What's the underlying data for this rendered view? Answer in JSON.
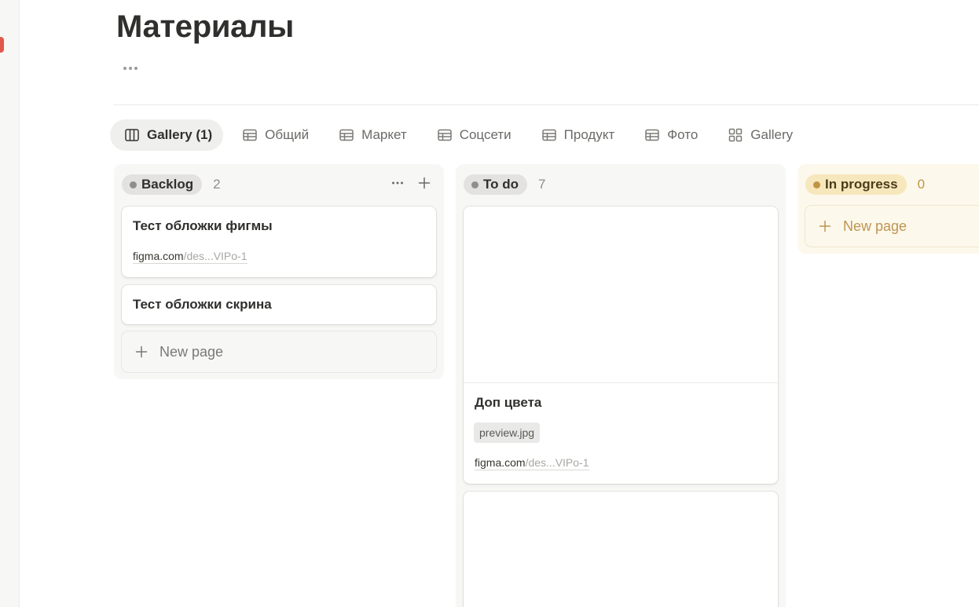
{
  "page": {
    "title": "Материалы",
    "more_label": "More options"
  },
  "tabs": [
    {
      "label": "Gallery (1)",
      "icon": "board-icon",
      "active": true
    },
    {
      "label": "Общий",
      "icon": "table-icon"
    },
    {
      "label": "Маркет",
      "icon": "table-icon"
    },
    {
      "label": "Соцсети",
      "icon": "table-icon"
    },
    {
      "label": "Продукт",
      "icon": "table-icon"
    },
    {
      "label": "Фото",
      "icon": "table-icon"
    },
    {
      "label": "Gallery",
      "icon": "gallery-icon"
    }
  ],
  "columns": {
    "backlog": {
      "status": "Backlog",
      "count": "2",
      "color": "#8f8e8a",
      "cards": [
        {
          "title": "Тест обложки фигмы",
          "link_domain": "figma.com",
          "link_rest": "/des...VIPo-1"
        },
        {
          "title": "Тест обложки скрина"
        }
      ],
      "new_page": "New page"
    },
    "todo": {
      "status": "To do",
      "count": "7",
      "color": "#8f8e8a",
      "cards": [
        {
          "title": "Доп цвета",
          "file": "preview.jpg",
          "link_domain": "figma.com",
          "link_rest": "/des...VIPo-1"
        }
      ]
    },
    "in_progress": {
      "status": "In progress",
      "count": "0",
      "color": "#c29343",
      "new_page": "New page"
    }
  }
}
